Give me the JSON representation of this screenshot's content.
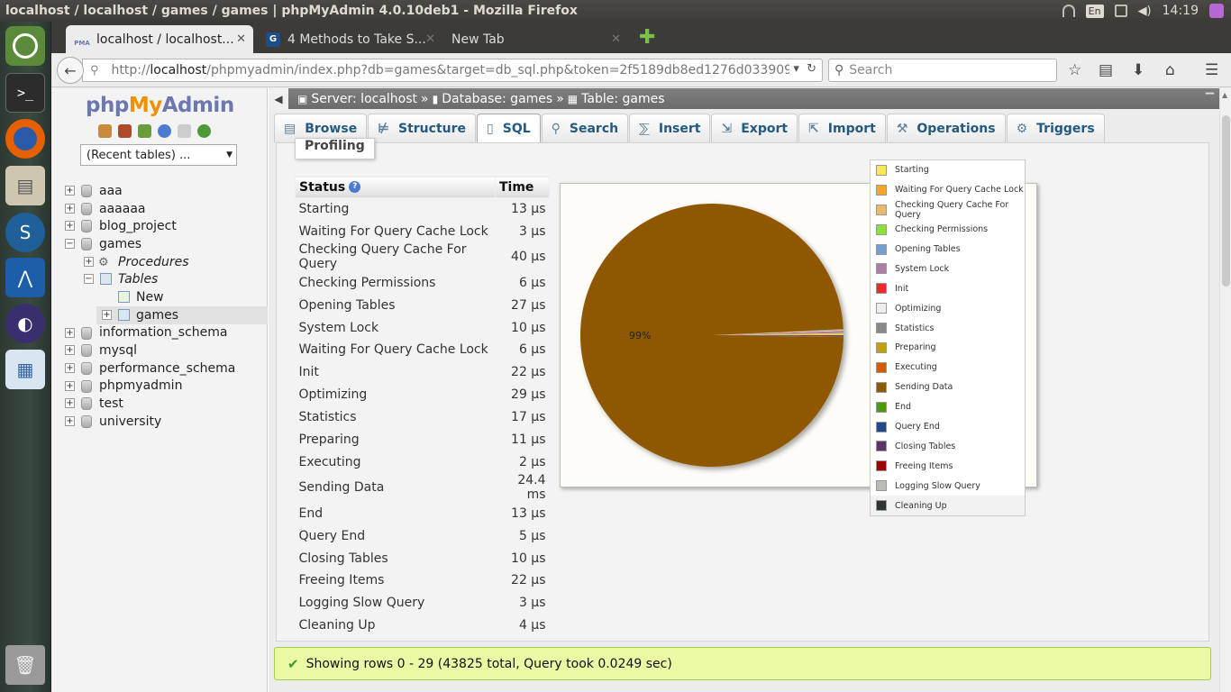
{
  "os": {
    "window_title": "localhost / localhost / games / games | phpMyAdmin 4.0.10deb1 - Mozilla Firefox",
    "lang": "En",
    "clock": "14:19"
  },
  "browser": {
    "tabs": [
      {
        "label": "localhost / localhost...",
        "favicon": "PMA"
      },
      {
        "label": "4 Methods to Take S...",
        "favicon": "G"
      },
      {
        "label": "New Tab"
      }
    ],
    "url_prefix": "http://",
    "url_host": "localhost",
    "url_rest": "/phpmyadmin/index.php?db=games&target=db_sql.php&token=2f5189db8ed1276d0339095",
    "search_placeholder": "Search"
  },
  "sidebar": {
    "logo": {
      "php": "php",
      "my": "My",
      "admin": "Admin"
    },
    "recent": "(Recent tables) ...",
    "tree": [
      {
        "label": "aaa"
      },
      {
        "label": "aaaaaa"
      },
      {
        "label": "blog_project"
      },
      {
        "label": "games"
      },
      {
        "label": "Procedures"
      },
      {
        "label": "Tables"
      },
      {
        "label": "New"
      },
      {
        "label": "games"
      },
      {
        "label": "information_schema"
      },
      {
        "label": "mysql"
      },
      {
        "label": "performance_schema"
      },
      {
        "label": "phpmyadmin"
      },
      {
        "label": "test"
      },
      {
        "label": "university"
      }
    ]
  },
  "breadcrumb": {
    "server": "Server: localhost",
    "sep": "»",
    "database": "Database: games",
    "table": "Table: games"
  },
  "tabs": [
    "Browse",
    "Structure",
    "SQL",
    "Search",
    "Insert",
    "Export",
    "Import",
    "Operations",
    "Triggers"
  ],
  "profiling": {
    "legend": "Profiling",
    "col_status": "Status",
    "col_time": "Time",
    "rows": [
      {
        "status": "Starting",
        "time": "13 µs"
      },
      {
        "status": "Waiting For Query Cache Lock",
        "time": "3 µs"
      },
      {
        "status": "Checking Query Cache For Query",
        "time": "40 µs"
      },
      {
        "status": "Checking Permissions",
        "time": "6 µs"
      },
      {
        "status": "Opening Tables",
        "time": "27 µs"
      },
      {
        "status": "System Lock",
        "time": "10 µs"
      },
      {
        "status": "Waiting For Query Cache Lock",
        "time": "6 µs"
      },
      {
        "status": "Init",
        "time": "22 µs"
      },
      {
        "status": "Optimizing",
        "time": "29 µs"
      },
      {
        "status": "Statistics",
        "time": "17 µs"
      },
      {
        "status": "Preparing",
        "time": "11 µs"
      },
      {
        "status": "Executing",
        "time": "2 µs"
      },
      {
        "status": "Sending Data",
        "time": "24.4 ms"
      },
      {
        "status": "End",
        "time": "13 µs"
      },
      {
        "status": "Query End",
        "time": "5 µs"
      },
      {
        "status": "Closing Tables",
        "time": "10 µs"
      },
      {
        "status": "Freeing Items",
        "time": "22 µs"
      },
      {
        "status": "Logging Slow Query",
        "time": "3 µs"
      },
      {
        "status": "Cleaning Up",
        "time": "4 µs"
      }
    ]
  },
  "chart_data": {
    "type": "pie",
    "slice_label": "99%",
    "slices": [
      {
        "name": "Starting",
        "value": 13,
        "color": "#fce94f"
      },
      {
        "name": "Waiting For Query Cache Lock",
        "value": 9,
        "color": "#f5a623"
      },
      {
        "name": "Checking Query Cache For Query",
        "value": 40,
        "color": "#e9b96e"
      },
      {
        "name": "Checking Permissions",
        "value": 6,
        "color": "#8ae234"
      },
      {
        "name": "Opening Tables",
        "value": 27,
        "color": "#729fcf"
      },
      {
        "name": "System Lock",
        "value": 10,
        "color": "#ad7fa8"
      },
      {
        "name": "Init",
        "value": 22,
        "color": "#ef2929"
      },
      {
        "name": "Optimizing",
        "value": 29,
        "color": "#eeeeec"
      },
      {
        "name": "Statistics",
        "value": 17,
        "color": "#888a85"
      },
      {
        "name": "Preparing",
        "value": 11,
        "color": "#c4a000"
      },
      {
        "name": "Executing",
        "value": 2,
        "color": "#ce5c00"
      },
      {
        "name": "Sending Data",
        "value": 24400,
        "color": "#8f5902"
      },
      {
        "name": "End",
        "value": 13,
        "color": "#4e9a06"
      },
      {
        "name": "Query End",
        "value": 5,
        "color": "#204a87"
      },
      {
        "name": "Closing Tables",
        "value": 10,
        "color": "#5c3566"
      },
      {
        "name": "Freeing Items",
        "value": 22,
        "color": "#a40000"
      },
      {
        "name": "Logging Slow Query",
        "value": 3,
        "color": "#babdb6"
      },
      {
        "name": "Cleaning Up",
        "value": 4,
        "color": "#2e3436"
      }
    ]
  },
  "legend_items": [
    {
      "label": "Starting",
      "color": "#fce94f"
    },
    {
      "label": "Waiting For Query Cache Lock",
      "color": "#f5a623"
    },
    {
      "label": "Checking Query Cache For Query",
      "color": "#e9b96e"
    },
    {
      "label": "Checking Permissions",
      "color": "#8ae234"
    },
    {
      "label": "Opening Tables",
      "color": "#729fcf"
    },
    {
      "label": "System Lock",
      "color": "#ad7fa8"
    },
    {
      "label": "Init",
      "color": "#ef2929"
    },
    {
      "label": "Optimizing",
      "color": "#eeeeec"
    },
    {
      "label": "Statistics",
      "color": "#888a85"
    },
    {
      "label": "Preparing",
      "color": "#c4a000"
    },
    {
      "label": "Executing",
      "color": "#ce5c00"
    },
    {
      "label": "Sending Data",
      "color": "#8f5902"
    },
    {
      "label": "End",
      "color": "#4e9a06"
    },
    {
      "label": "Query End",
      "color": "#204a87"
    },
    {
      "label": "Closing Tables",
      "color": "#5c3566"
    },
    {
      "label": "Freeing Items",
      "color": "#a40000"
    },
    {
      "label": "Logging Slow Query",
      "color": "#babdb6"
    },
    {
      "label": "Cleaning Up",
      "color": "#2e3436"
    }
  ],
  "success_message": "Showing rows 0 - 29 (43825 total, Query took 0.0249 sec)"
}
